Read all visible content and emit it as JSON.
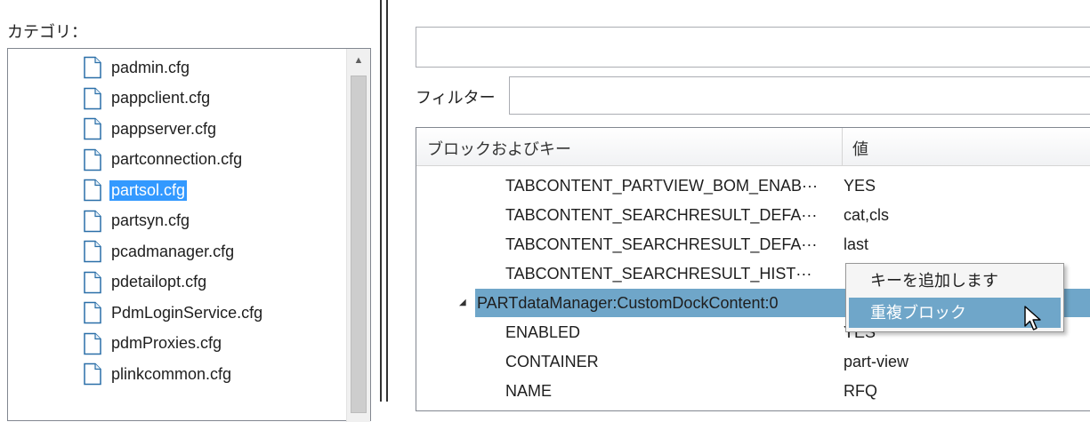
{
  "category_label": "カテゴリ：",
  "files": [
    {
      "name": "padmin.cfg",
      "selected": false
    },
    {
      "name": "pappclient.cfg",
      "selected": false
    },
    {
      "name": "pappserver.cfg",
      "selected": false
    },
    {
      "name": "partconnection.cfg",
      "selected": false
    },
    {
      "name": "partsol.cfg",
      "selected": true
    },
    {
      "name": "partsyn.cfg",
      "selected": false
    },
    {
      "name": "pcadmanager.cfg",
      "selected": false
    },
    {
      "name": "pdetailopt.cfg",
      "selected": false
    },
    {
      "name": "PdmLoginService.cfg",
      "selected": false
    },
    {
      "name": "pdmProxies.cfg",
      "selected": false
    },
    {
      "name": "plinkcommon.cfg",
      "selected": false
    }
  ],
  "filter": {
    "label": "フィルター",
    "value": "",
    "placeholder": ""
  },
  "top_field": {
    "value": ""
  },
  "grid": {
    "header_key": "ブロックおよびキー",
    "header_value": "値",
    "rows": [
      {
        "key": "TABCONTENT_PARTVIEW_BOM_ENAB···",
        "value": "YES"
      },
      {
        "key": "TABCONTENT_SEARCHRESULT_DEFA···",
        "value": "cat,cls"
      },
      {
        "key": "TABCONTENT_SEARCHRESULT_DEFA···",
        "value": "last"
      },
      {
        "key": "TABCONTENT_SEARCHRESULT_HIST···",
        "value": ""
      },
      {
        "key": "PARTdataManager:CustomDockContent:0",
        "value": "",
        "block": true
      },
      {
        "key": "ENABLED",
        "value": "YES"
      },
      {
        "key": "CONTAINER",
        "value": "part-view"
      },
      {
        "key": "NAME",
        "value": "RFQ"
      }
    ]
  },
  "context_menu": {
    "items": [
      {
        "label": "キーを追加します"
      },
      {
        "label": "重複ブロック"
      }
    ]
  },
  "colors": {
    "selection": "#3399ff",
    "row_highlight": "#6fa6c9",
    "border": "#828790"
  },
  "icons": {
    "file": "file-icon",
    "expand": "expand-triangle-icon",
    "cursor": "mouse-pointer-icon",
    "scroll_up": "scroll-up-arrow-icon"
  }
}
